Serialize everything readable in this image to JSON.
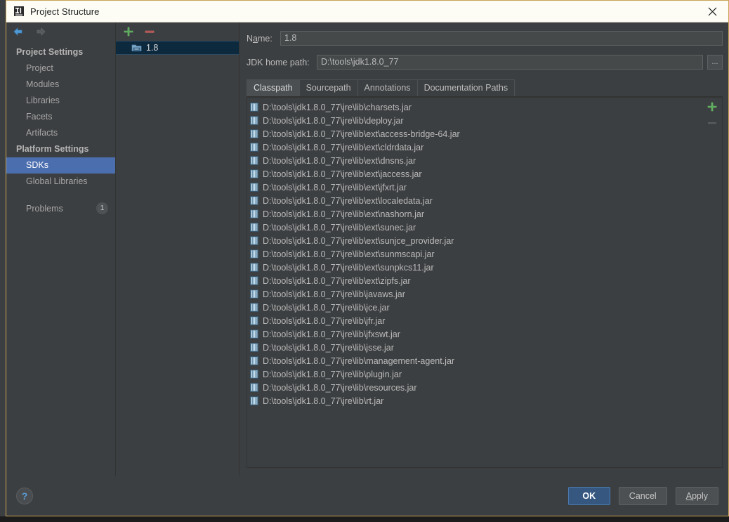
{
  "window": {
    "title": "Project Structure",
    "title_icon": "intellij-idea-icon",
    "close_icon": "close-icon",
    "accent_border": "#c8a456"
  },
  "nav": {
    "back_icon": "arrow-left-icon",
    "forward_icon": "arrow-right-icon"
  },
  "sidebar": {
    "groups": [
      {
        "label": "Project Settings",
        "items": [
          {
            "label": "Project",
            "selected": false
          },
          {
            "label": "Modules",
            "selected": false
          },
          {
            "label": "Libraries",
            "selected": false
          },
          {
            "label": "Facets",
            "selected": false
          },
          {
            "label": "Artifacts",
            "selected": false
          }
        ]
      },
      {
        "label": "Platform Settings",
        "items": [
          {
            "label": "SDKs",
            "selected": true
          },
          {
            "label": "Global Libraries",
            "selected": false
          }
        ]
      }
    ],
    "problems": {
      "label": "Problems",
      "count": "1"
    }
  },
  "sdk_panel": {
    "add_icon": "plus-icon",
    "remove_icon": "minus-icon",
    "items": [
      {
        "label": "1.8",
        "icon": "jdk-folder-icon",
        "selected": true
      }
    ]
  },
  "detail": {
    "name_label_pre": "N",
    "name_label_mnemonic": "a",
    "name_label_post": "me:",
    "name_value": "1.8",
    "path_label": "JDK home path:",
    "path_value": "D:\\tools\\jdk1.8.0_77",
    "browse_label": "...",
    "tabs": [
      {
        "label": "Classpath",
        "active": true
      },
      {
        "label": "Sourcepath",
        "active": false
      },
      {
        "label": "Annotations",
        "active": false
      },
      {
        "label": "Documentation Paths",
        "active": false
      }
    ],
    "side_add_icon": "plus-icon",
    "side_remove_icon": "minus-icon",
    "classpath_entries": [
      "D:\\tools\\jdk1.8.0_77\\jre\\lib\\charsets.jar",
      "D:\\tools\\jdk1.8.0_77\\jre\\lib\\deploy.jar",
      "D:\\tools\\jdk1.8.0_77\\jre\\lib\\ext\\access-bridge-64.jar",
      "D:\\tools\\jdk1.8.0_77\\jre\\lib\\ext\\cldrdata.jar",
      "D:\\tools\\jdk1.8.0_77\\jre\\lib\\ext\\dnsns.jar",
      "D:\\tools\\jdk1.8.0_77\\jre\\lib\\ext\\jaccess.jar",
      "D:\\tools\\jdk1.8.0_77\\jre\\lib\\ext\\jfxrt.jar",
      "D:\\tools\\jdk1.8.0_77\\jre\\lib\\ext\\localedata.jar",
      "D:\\tools\\jdk1.8.0_77\\jre\\lib\\ext\\nashorn.jar",
      "D:\\tools\\jdk1.8.0_77\\jre\\lib\\ext\\sunec.jar",
      "D:\\tools\\jdk1.8.0_77\\jre\\lib\\ext\\sunjce_provider.jar",
      "D:\\tools\\jdk1.8.0_77\\jre\\lib\\ext\\sunmscapi.jar",
      "D:\\tools\\jdk1.8.0_77\\jre\\lib\\ext\\sunpkcs11.jar",
      "D:\\tools\\jdk1.8.0_77\\jre\\lib\\ext\\zipfs.jar",
      "D:\\tools\\jdk1.8.0_77\\jre\\lib\\javaws.jar",
      "D:\\tools\\jdk1.8.0_77\\jre\\lib\\jce.jar",
      "D:\\tools\\jdk1.8.0_77\\jre\\lib\\jfr.jar",
      "D:\\tools\\jdk1.8.0_77\\jre\\lib\\jfxswt.jar",
      "D:\\tools\\jdk1.8.0_77\\jre\\lib\\jsse.jar",
      "D:\\tools\\jdk1.8.0_77\\jre\\lib\\management-agent.jar",
      "D:\\tools\\jdk1.8.0_77\\jre\\lib\\plugin.jar",
      "D:\\tools\\jdk1.8.0_77\\jre\\lib\\resources.jar",
      "D:\\tools\\jdk1.8.0_77\\jre\\lib\\rt.jar"
    ]
  },
  "footer": {
    "help_label": "?",
    "ok_label": "OK",
    "cancel_label": "Cancel",
    "apply_label_mnemonic": "A",
    "apply_label_rest": "pply"
  }
}
